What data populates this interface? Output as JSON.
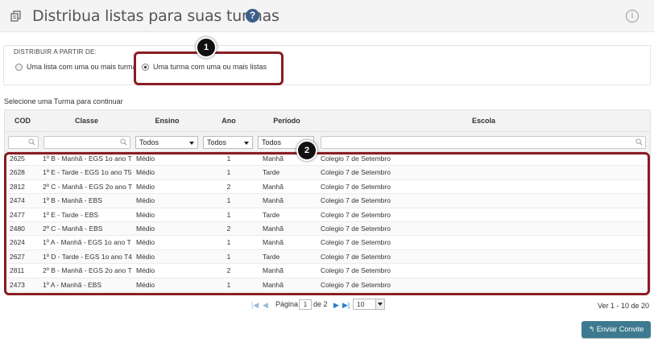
{
  "header": {
    "title": "Distribua listas para suas turmas",
    "help_glyph": "?",
    "info_glyph": "i"
  },
  "distribute": {
    "legend": "DISTRIBUIR A PARTIR DE:",
    "options": [
      {
        "label": "Uma lista com uma ou mais turmas",
        "checked": false
      },
      {
        "label": "Uma turma com uma ou mais listas",
        "checked": true
      }
    ]
  },
  "callouts": {
    "first": "1",
    "second": "2"
  },
  "hint": "Selecione uma Turma para continuar",
  "grid": {
    "columns": [
      "COD",
      "Classe",
      "Ensino",
      "Ano",
      "Período",
      "Escola"
    ],
    "filters": {
      "ensino": "Todos",
      "ano": "Todos",
      "periodo": "Todos"
    },
    "rows": [
      {
        "cod": "2625",
        "classe": "1º B - Manhã - EGS 1o ano T",
        "ensino": "Médio",
        "ano": "1",
        "periodo": "Manhã",
        "escola": "Colegio 7 de Setembro"
      },
      {
        "cod": "2628",
        "classe": "1º E - Tarde - EGS 1o ano T5",
        "ensino": "Médio",
        "ano": "1",
        "periodo": "Tarde",
        "escola": "Colegio 7 de Setembro"
      },
      {
        "cod": "2812",
        "classe": "2º C - Manhã - EGS 2o ano T",
        "ensino": "Médio",
        "ano": "2",
        "periodo": "Manhã",
        "escola": "Colegio 7 de Setembro"
      },
      {
        "cod": "2474",
        "classe": "1º B - Manhã - EBS",
        "ensino": "Médio",
        "ano": "1",
        "periodo": "Manhã",
        "escola": "Colegio 7 de Setembro"
      },
      {
        "cod": "2477",
        "classe": "1º E - Tarde - EBS",
        "ensino": "Médio",
        "ano": "1",
        "periodo": "Tarde",
        "escola": "Colegio 7 de Setembro"
      },
      {
        "cod": "2480",
        "classe": "2º C - Manhã - EBS",
        "ensino": "Médio",
        "ano": "2",
        "periodo": "Manhã",
        "escola": "Colegio 7 de Setembro"
      },
      {
        "cod": "2624",
        "classe": "1º A - Manhã - EGS 1o ano T",
        "ensino": "Médio",
        "ano": "1",
        "periodo": "Manhã",
        "escola": "Colegio 7 de Setembro"
      },
      {
        "cod": "2627",
        "classe": "1º D - Tarde - EGS 1o ano T4",
        "ensino": "Médio",
        "ano": "1",
        "periodo": "Tarde",
        "escola": "Colegio 7 de Setembro"
      },
      {
        "cod": "2811",
        "classe": "2º B - Manhã - EGS 2o ano T",
        "ensino": "Médio",
        "ano": "2",
        "periodo": "Manhã",
        "escola": "Colegio 7 de Setembro"
      },
      {
        "cod": "2473",
        "classe": "1º A - Manhã - EBS",
        "ensino": "Médio",
        "ano": "1",
        "periodo": "Manhã",
        "escola": "Colegio 7 de Setembro"
      }
    ]
  },
  "pager": {
    "page_label": "Página",
    "page": "1",
    "of_label": "de 2",
    "page_size": "10",
    "summary": "Ver 1 - 10 de 20"
  },
  "actions": {
    "send_label": "Enviar Convite"
  },
  "colors": {
    "accent": "#3e7a8f",
    "callout": "#8a1c24",
    "help": "#3b5f8a"
  }
}
